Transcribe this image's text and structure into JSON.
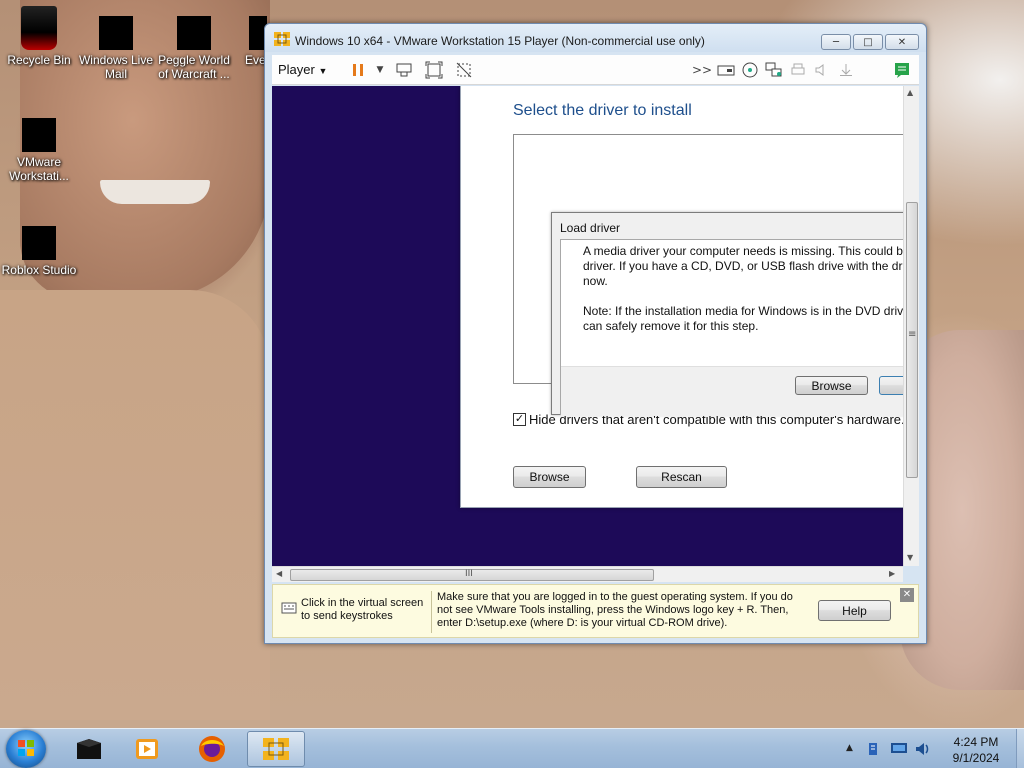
{
  "desktop": {
    "icons": [
      {
        "label": "Recycle Bin"
      },
      {
        "label": "Windows Live Mail"
      },
      {
        "label": "Peggle World of Warcraft ..."
      },
      {
        "label": "Eve"
      },
      {
        "label": "VMware Workstati..."
      },
      {
        "label": "Roblox Studio"
      }
    ]
  },
  "vmware": {
    "title": "Windows 10 x64 - VMware Workstation 15 Player (Non-commercial use only)",
    "menu": {
      "player_label": "Player"
    },
    "toolbar_icons": [
      "pause-icon",
      "dropdown-icon",
      "send-ctrl-alt-del-icon",
      "fit-guest-icon",
      "unity-icon",
      "more-icon",
      "removable-device-icon",
      "cd-icon",
      "network-icon",
      "printer-icon",
      "sound-icon",
      "usb-icon",
      "message-icon"
    ],
    "infobar": {
      "left_text": "Click in the virtual screen to send keystrokes",
      "message": "Make sure that you are logged in to the guest operating system. If you do not see VMware Tools installing, press the Windows logo key + R. Then, enter D:\\setup.exe (where D: is your virtual CD-ROM drive).",
      "help_label": "Help"
    },
    "hscroll_grip": "III",
    "vscroll_grip": "≡"
  },
  "setup": {
    "title": "Select the driver to install",
    "hide_checkbox_label": "Hide drivers that aren't compatible with this computer's hardware.",
    "hide_checkbox_checked": true,
    "browse_label": "Browse",
    "rescan_label": "Rescan"
  },
  "load_driver": {
    "title": "Load driver",
    "paragraph1": "A media driver your computer needs is missing. This could b driver. If you have a CD, DVD, or USB flash drive with the driv now.",
    "line1": "A media driver your computer needs is missing. This could b",
    "line2": "driver. If you have a CD, DVD, or USB flash drive with the driv",
    "line3": "now.",
    "line4": "Note: If the installation media for Windows is in the DVD driv",
    "line5": "can safely remove it for this step.",
    "browse_label": "Browse"
  },
  "taskbar": {
    "apps": [
      "start-button",
      "terminal-app",
      "media-player-app",
      "firefox-app",
      "vmware-player-app"
    ],
    "clock_time": "4:24 PM",
    "clock_date": "9/1/2024"
  }
}
